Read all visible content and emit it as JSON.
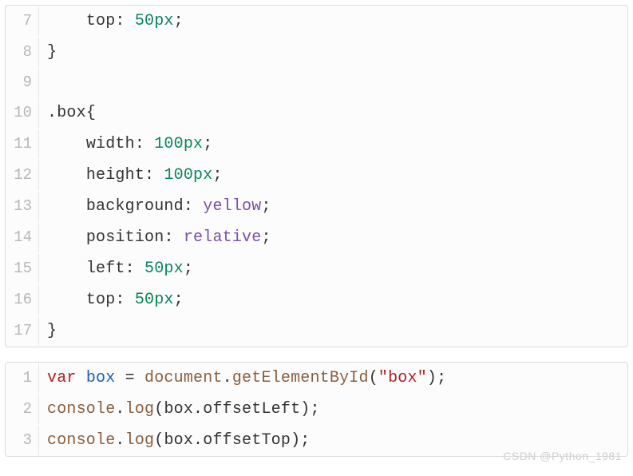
{
  "block1": {
    "lines": [
      {
        "n": 7,
        "tokens": [
          {
            "cls": "token-plain",
            "t": "    "
          },
          {
            "cls": "token-property",
            "t": "top"
          },
          {
            "cls": "token-punct",
            "t": ": "
          },
          {
            "cls": "token-number",
            "t": "50px"
          },
          {
            "cls": "token-punct",
            "t": ";"
          }
        ]
      },
      {
        "n": 8,
        "tokens": [
          {
            "cls": "token-punct",
            "t": "}"
          }
        ]
      },
      {
        "n": 9,
        "tokens": [
          {
            "cls": "token-plain",
            "t": ""
          }
        ]
      },
      {
        "n": 10,
        "tokens": [
          {
            "cls": "token-selector",
            "t": ".box"
          },
          {
            "cls": "token-punct",
            "t": "{"
          }
        ]
      },
      {
        "n": 11,
        "tokens": [
          {
            "cls": "token-plain",
            "t": "    "
          },
          {
            "cls": "token-property",
            "t": "width"
          },
          {
            "cls": "token-punct",
            "t": ": "
          },
          {
            "cls": "token-number",
            "t": "100px"
          },
          {
            "cls": "token-punct",
            "t": ";"
          }
        ]
      },
      {
        "n": 12,
        "tokens": [
          {
            "cls": "token-plain",
            "t": "    "
          },
          {
            "cls": "token-property",
            "t": "height"
          },
          {
            "cls": "token-punct",
            "t": ": "
          },
          {
            "cls": "token-number",
            "t": "100px"
          },
          {
            "cls": "token-punct",
            "t": ";"
          }
        ]
      },
      {
        "n": 13,
        "tokens": [
          {
            "cls": "token-plain",
            "t": "    "
          },
          {
            "cls": "token-property",
            "t": "background"
          },
          {
            "cls": "token-punct",
            "t": ": "
          },
          {
            "cls": "token-colorval",
            "t": "yellow"
          },
          {
            "cls": "token-punct",
            "t": ";"
          }
        ]
      },
      {
        "n": 14,
        "tokens": [
          {
            "cls": "token-plain",
            "t": "    "
          },
          {
            "cls": "token-property",
            "t": "position"
          },
          {
            "cls": "token-punct",
            "t": ": "
          },
          {
            "cls": "token-colorval",
            "t": "relative"
          },
          {
            "cls": "token-punct",
            "t": ";"
          }
        ]
      },
      {
        "n": 15,
        "tokens": [
          {
            "cls": "token-plain",
            "t": "    "
          },
          {
            "cls": "token-property",
            "t": "left"
          },
          {
            "cls": "token-punct",
            "t": ": "
          },
          {
            "cls": "token-number",
            "t": "50px"
          },
          {
            "cls": "token-punct",
            "t": ";"
          }
        ]
      },
      {
        "n": 16,
        "tokens": [
          {
            "cls": "token-plain",
            "t": "    "
          },
          {
            "cls": "token-property",
            "t": "top"
          },
          {
            "cls": "token-punct",
            "t": ": "
          },
          {
            "cls": "token-number",
            "t": "50px"
          },
          {
            "cls": "token-punct",
            "t": ";"
          }
        ]
      },
      {
        "n": 17,
        "tokens": [
          {
            "cls": "token-punct",
            "t": "}"
          }
        ]
      }
    ]
  },
  "block2": {
    "lines": [
      {
        "n": 1,
        "tokens": [
          {
            "cls": "token-keyword",
            "t": "var"
          },
          {
            "cls": "token-plain",
            "t": " "
          },
          {
            "cls": "token-ident",
            "t": "box"
          },
          {
            "cls": "token-plain",
            "t": " "
          },
          {
            "cls": "token-punct",
            "t": "="
          },
          {
            "cls": "token-plain",
            "t": " "
          },
          {
            "cls": "token-builtin",
            "t": "document"
          },
          {
            "cls": "token-punct",
            "t": "."
          },
          {
            "cls": "token-method",
            "t": "getElementById"
          },
          {
            "cls": "token-punct",
            "t": "("
          },
          {
            "cls": "token-string",
            "t": "\"box\""
          },
          {
            "cls": "token-punct",
            "t": ");"
          }
        ]
      },
      {
        "n": 2,
        "tokens": [
          {
            "cls": "token-builtin",
            "t": "console"
          },
          {
            "cls": "token-punct",
            "t": "."
          },
          {
            "cls": "token-method",
            "t": "log"
          },
          {
            "cls": "token-punct",
            "t": "("
          },
          {
            "cls": "token-plain",
            "t": "box"
          },
          {
            "cls": "token-punct",
            "t": "."
          },
          {
            "cls": "token-plain",
            "t": "offsetLeft"
          },
          {
            "cls": "token-punct",
            "t": ");"
          }
        ]
      },
      {
        "n": 3,
        "tokens": [
          {
            "cls": "token-builtin",
            "t": "console"
          },
          {
            "cls": "token-punct",
            "t": "."
          },
          {
            "cls": "token-method",
            "t": "log"
          },
          {
            "cls": "token-punct",
            "t": "("
          },
          {
            "cls": "token-plain",
            "t": "box"
          },
          {
            "cls": "token-punct",
            "t": "."
          },
          {
            "cls": "token-plain",
            "t": "offsetTop"
          },
          {
            "cls": "token-punct",
            "t": ");"
          }
        ]
      }
    ]
  },
  "watermark": "CSDN @Python_1981"
}
